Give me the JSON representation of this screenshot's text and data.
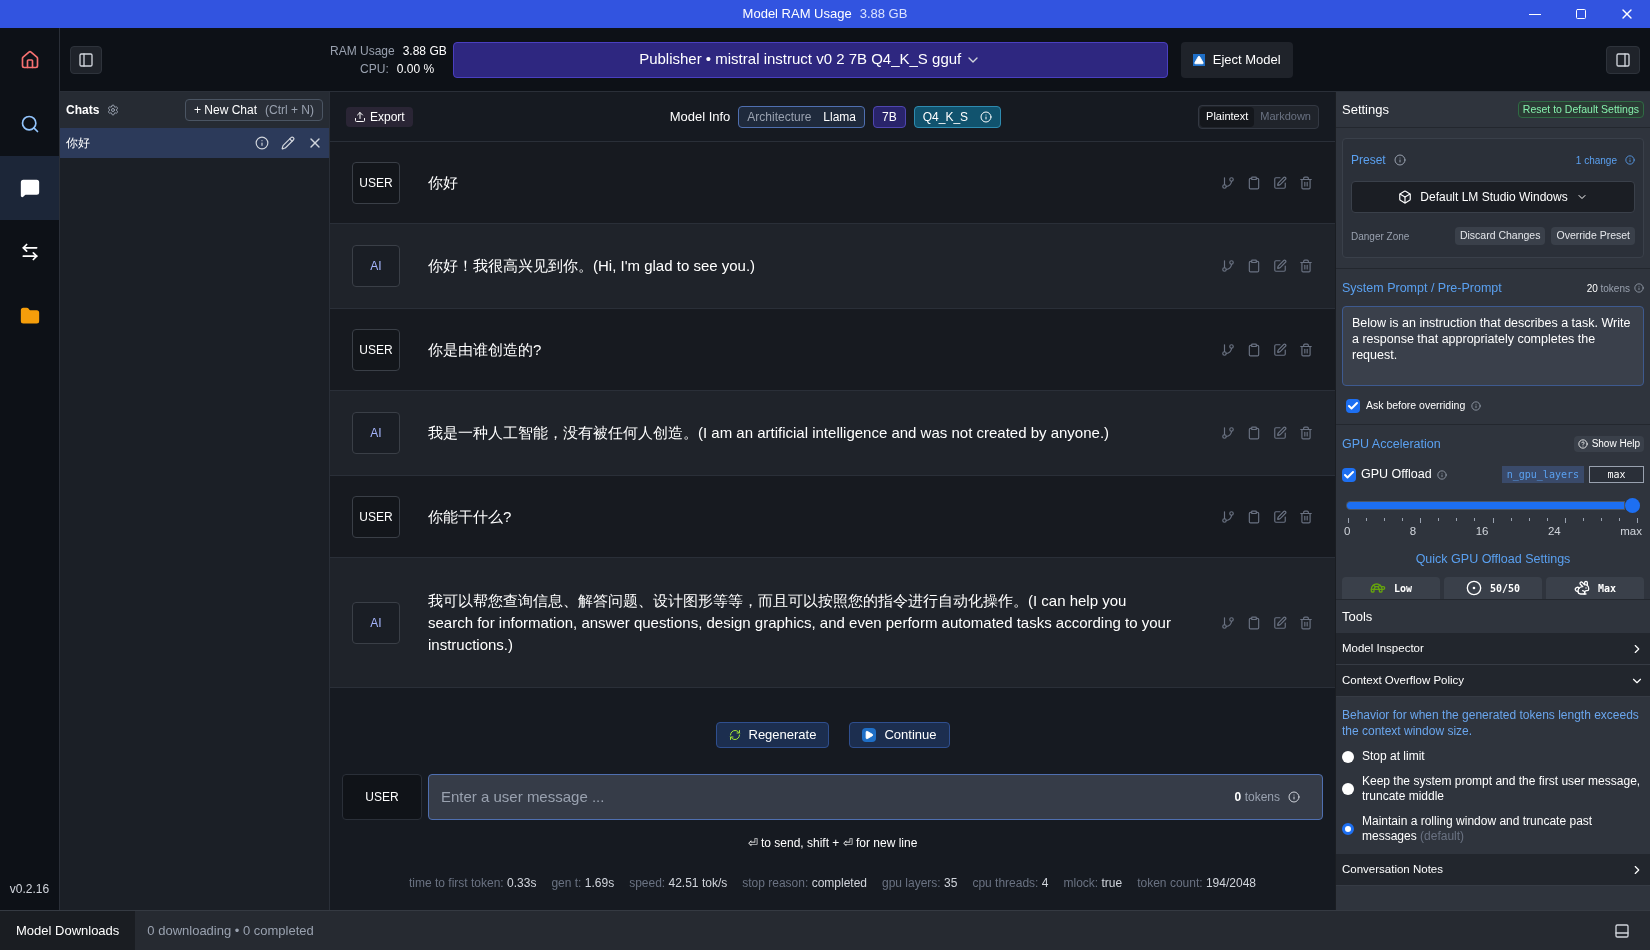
{
  "title_bar": {
    "title": "Model RAM Usage",
    "value": "3.88 GB"
  },
  "nav": [
    {
      "kind": "home",
      "selected": false
    },
    {
      "kind": "search",
      "selected": false
    },
    {
      "kind": "chat",
      "selected": true
    },
    {
      "kind": "arrows",
      "selected": false
    },
    {
      "kind": "folder",
      "selected": false
    }
  ],
  "version": "v0.2.16",
  "top_bar": {
    "ram_label": "RAM Usage",
    "ram_value": "3.88 GB",
    "cpu_label": "CPU:",
    "cpu_value": "0.00 %",
    "model": "Publisher • mistral instruct v0 2 7B Q4_K_S gguf",
    "eject": "Eject Model"
  },
  "chats": {
    "title": "Chats",
    "new_chat": "+ New Chat",
    "shortcut": "(Ctrl + N)",
    "items": [
      {
        "title": "你好",
        "selected": true
      }
    ]
  },
  "chat_header": {
    "export": "Export",
    "model_info": "Model Info",
    "arch_label": "Architecture",
    "arch_value": "Llama",
    "size": "7B",
    "quant": "Q4_K_S",
    "tabs": [
      {
        "label": "Plaintext",
        "selected": true
      },
      {
        "label": "Markdown",
        "selected": false
      }
    ]
  },
  "messages": [
    {
      "role": "USER",
      "text": "你好"
    },
    {
      "role": "AI",
      "text": "你好！我很高兴见到你。(Hi, I'm glad to see you.)"
    },
    {
      "role": "USER",
      "text": "你是由谁创造的?"
    },
    {
      "role": "AI",
      "text": "我是一种人工智能，没有被任何人创造。(I am an artificial intelligence and was not created by anyone.)"
    },
    {
      "role": "USER",
      "text": "你能干什么?"
    },
    {
      "role": "AI",
      "text": "我可以帮您查询信息、解答问题、设计图形等等，而且可以按照您的指令进行自动化操作。(I can help you search for information, answer questions, design graphics, and even perform automated tasks according to your instructions.)"
    }
  ],
  "actions": [
    "Regenerate",
    "Continue"
  ],
  "composer": {
    "role": "USER",
    "placeholder": "Enter a user message ...",
    "token_count": "0",
    "token_label": "tokens",
    "hint": "⏎ to send, shift + ⏎ for new line"
  },
  "stats": [
    {
      "label": "time to first token:",
      "value": "0.33s"
    },
    {
      "label": "gen t:",
      "value": "1.69s"
    },
    {
      "label": "speed:",
      "value": "42.51 tok/s"
    },
    {
      "label": "stop reason:",
      "value": "completed"
    },
    {
      "label": "gpu layers:",
      "value": "35"
    },
    {
      "label": "cpu threads:",
      "value": "4"
    },
    {
      "label": "mlock:",
      "value": "true"
    },
    {
      "label": "token count:",
      "value": "194/2048"
    }
  ],
  "settings": {
    "title": "Settings",
    "reset": "Reset to Default Settings",
    "preset": {
      "label": "Preset",
      "changes": "1 change",
      "value": "Default LM Studio Windows",
      "danger_label": "Danger Zone",
      "buttons": [
        "Discard Changes",
        "Override Preset"
      ]
    },
    "system_prompt": {
      "label": "System Prompt / Pre-Prompt",
      "token_count": "20",
      "token_label": "tokens",
      "value": "Below is an instruction that describes a task. Write a response that appropriately completes the request.",
      "ask_label": "Ask before overriding",
      "ask_checked": true
    },
    "gpu": {
      "label": "GPU Acceleration",
      "help": "Show Help",
      "offload_label": "GPU Offload",
      "offload_checked": true,
      "param": "n_gpu_layers",
      "param_value": "max",
      "level": 1,
      "ticks": [
        "0",
        "8",
        "16",
        "24",
        "max"
      ],
      "quick_label": "Quick GPU Offload Settings",
      "quick": [
        {
          "kind": "turtle",
          "label": "Low"
        },
        {
          "kind": "half",
          "label": "50/50"
        },
        {
          "kind": "rabbit",
          "label": "Max"
        }
      ]
    }
  },
  "tools": {
    "title": "Tools",
    "sections": [
      {
        "title": "Model Inspector",
        "expanded": false
      },
      {
        "title": "Context Overflow Policy",
        "expanded": true,
        "description": "Behavior for when the generated tokens length exceeds the context window size.",
        "options": [
          {
            "label": "Stop at limit",
            "selected": false
          },
          {
            "label": "Keep the system prompt and the first user message, truncate middle",
            "selected": false
          },
          {
            "label": "Maintain a rolling window and truncate past messages",
            "note": "(default)",
            "selected": true
          }
        ]
      },
      {
        "title": "Conversation Notes",
        "expanded": false
      }
    ]
  },
  "status_bar": {
    "label": "Model Downloads",
    "info": "0 downloading • 0 completed"
  }
}
